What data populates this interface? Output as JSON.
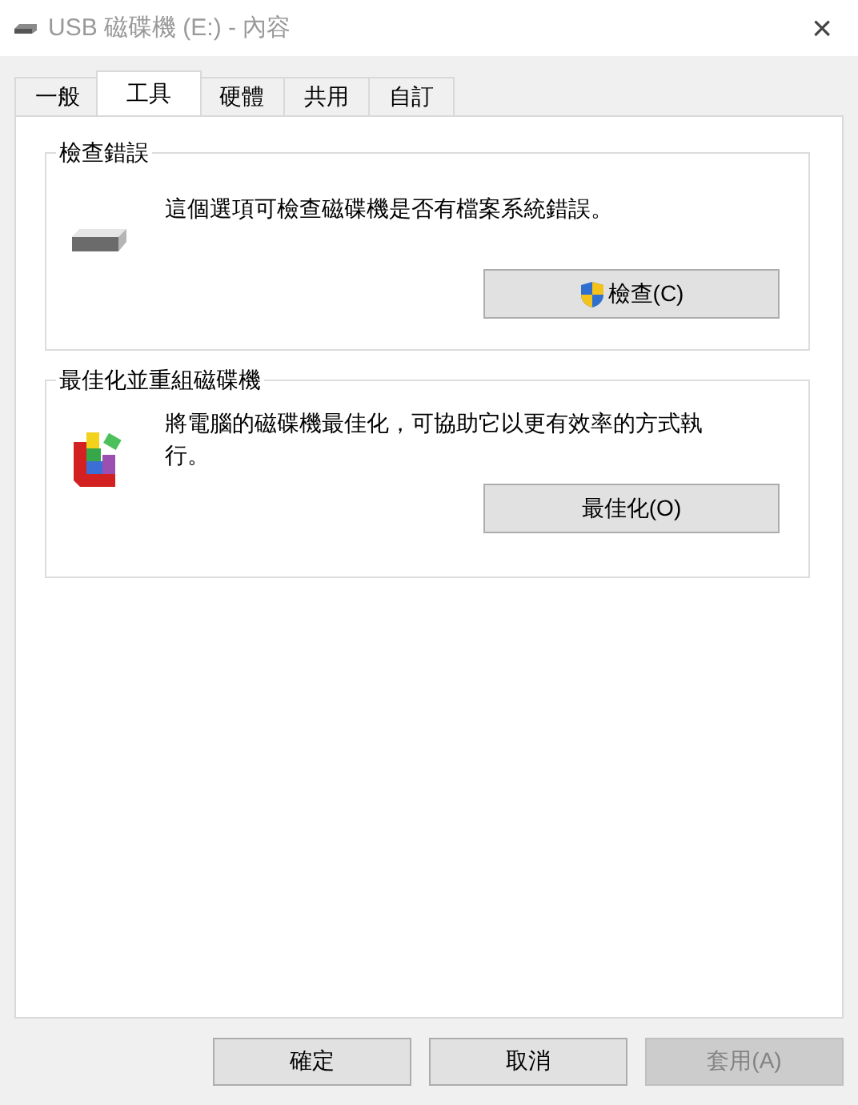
{
  "window": {
    "title": "USB 磁碟機 (E:) - 內容",
    "close": "×"
  },
  "tabs": [
    {
      "label": "一般",
      "selected": false
    },
    {
      "label": "工具",
      "selected": true
    },
    {
      "label": "硬體",
      "selected": false
    },
    {
      "label": "共用",
      "selected": false
    },
    {
      "label": "自訂",
      "selected": false
    }
  ],
  "groups": [
    {
      "kind": "check",
      "title": "檢查錯誤",
      "text": "這個選項可檢查磁碟機是否有檔案系統錯誤。",
      "button": {
        "label": "檢查(C)",
        "shield": true
      }
    },
    {
      "kind": "optimize",
      "title": "最佳化並重組磁碟機",
      "text": "將電腦的磁碟機最佳化，可協助它以更有效率的方式執行。",
      "button": {
        "label": "最佳化(O)",
        "shield": false
      }
    }
  ],
  "buttons": [
    {
      "label": "確定",
      "disabled": false
    },
    {
      "label": "取消",
      "disabled": false
    },
    {
      "label": "套用(A)",
      "disabled": true
    }
  ]
}
